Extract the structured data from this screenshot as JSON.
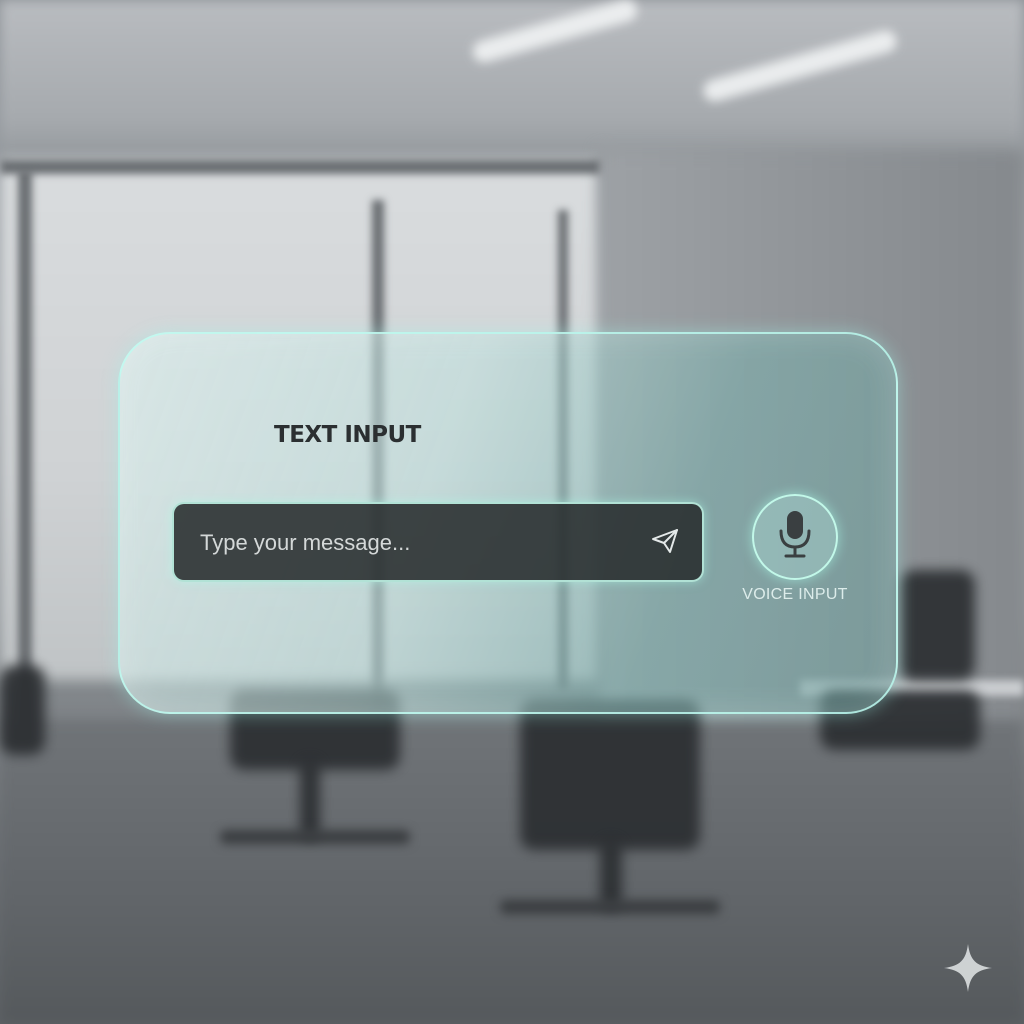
{
  "panel": {
    "title": "TEXT INPUT"
  },
  "message_input": {
    "value": "",
    "placeholder": "Type your message..."
  },
  "send_button": {
    "icon": "paper-plane-icon"
  },
  "voice_input": {
    "icon": "microphone-icon",
    "label": "VOICE INPUT"
  },
  "watermark": {
    "icon": "sparkle-icon"
  },
  "colors": {
    "glass_border": "#bef9f0",
    "field_background": "#282c2e",
    "title_text": "#2b2f31",
    "placeholder_text": "#d4d8d8"
  }
}
